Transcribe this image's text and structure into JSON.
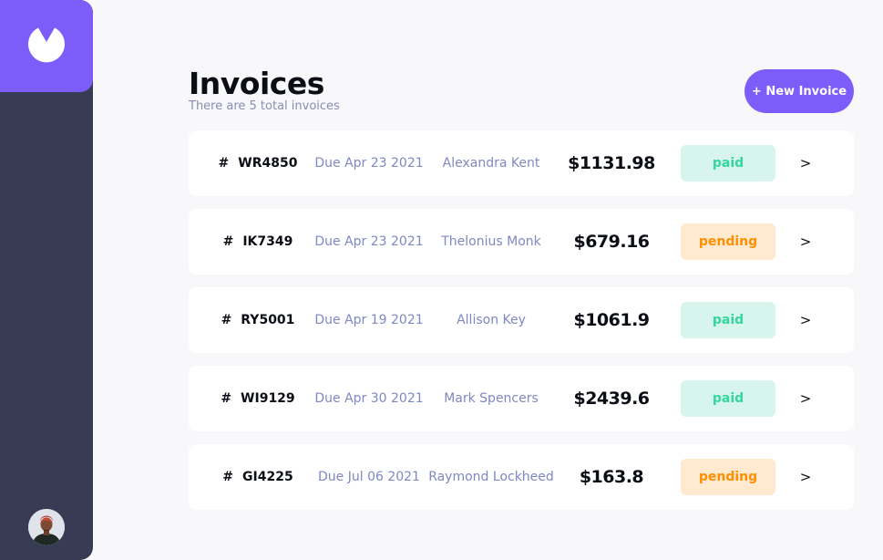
{
  "header": {
    "title": "Invoices",
    "subtitle": "There are 5 total invoices",
    "new_invoice_label": "+ New Invoice"
  },
  "colors": {
    "accent": "#7c5dfa",
    "sidebar": "#373b53",
    "paid_text": "#33d69f",
    "paid_bg": "#d7f5ec",
    "pending_text": "#ff8f00",
    "pending_bg": "#ffe9cf"
  },
  "sidebar": {
    "logo_icon": "logo-icon",
    "avatar_icon": "user-avatar"
  },
  "invoices": [
    {
      "hash": "#",
      "id": "WR4850",
      "due": "Due Apr 23 2021",
      "name": "Alexandra Kent",
      "amount": "$1131.98",
      "status": "paid",
      "arrow": ">"
    },
    {
      "hash": "#",
      "id": "IK7349",
      "due": "Due Apr 23 2021",
      "name": "Thelonius Monk",
      "amount": "$679.16",
      "status": "pending",
      "arrow": ">"
    },
    {
      "hash": "#",
      "id": "RY5001",
      "due": "Due Apr 19 2021",
      "name": "Allison Key",
      "amount": "$1061.9",
      "status": "paid",
      "arrow": ">"
    },
    {
      "hash": "#",
      "id": "WI9129",
      "due": "Due Apr 30 2021",
      "name": "Mark Spencers",
      "amount": "$2439.6",
      "status": "paid",
      "arrow": ">"
    },
    {
      "hash": "#",
      "id": "GI4225",
      "due": "Due Jul 06 2021",
      "name": "Raymond Lockheed",
      "amount": "$163.8",
      "status": "pending",
      "arrow": ">"
    }
  ]
}
